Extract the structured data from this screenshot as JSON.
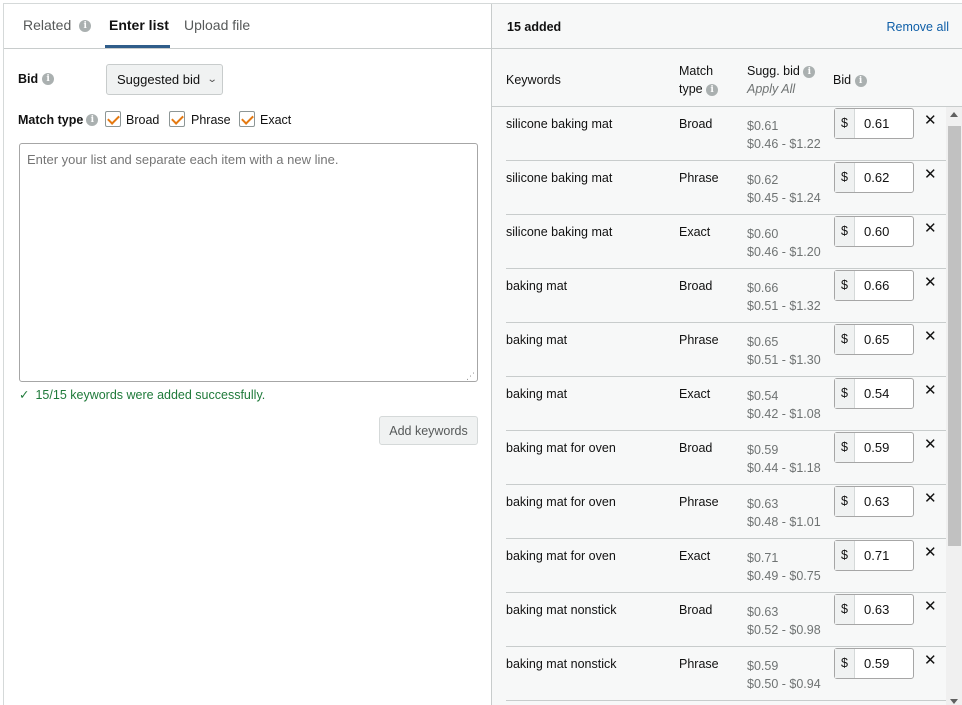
{
  "tabs": [
    {
      "label": "Related"
    },
    {
      "label": "Enter list"
    },
    {
      "label": "Upload file"
    }
  ],
  "bid": {
    "label": "Bid",
    "dropdown_value": "Suggested bid"
  },
  "match_type": {
    "label": "Match type",
    "options": [
      {
        "label": "Broad",
        "checked": true
      },
      {
        "label": "Phrase",
        "checked": true
      },
      {
        "label": "Exact",
        "checked": true
      }
    ]
  },
  "list_input": {
    "placeholder": "Enter your list and separate each item with a new line.",
    "value": ""
  },
  "success_message": "15/15 keywords were added successfully.",
  "add_keywords_label": "Add keywords",
  "right": {
    "added_label": "15 added",
    "remove_all_label": "Remove all",
    "columns": {
      "keywords": "Keywords",
      "match_type_line1": "Match",
      "match_type_line2": "type",
      "sugg_bid": "Sugg. bid",
      "apply_all": "Apply All",
      "bid": "Bid"
    },
    "currency": "$",
    "rows": [
      {
        "keyword": "silicone baking mat",
        "match": "Broad",
        "sugg": "$0.61",
        "range": "$0.46 - $1.22",
        "bid": "0.61"
      },
      {
        "keyword": "silicone baking mat",
        "match": "Phrase",
        "sugg": "$0.62",
        "range": "$0.45 - $1.24",
        "bid": "0.62"
      },
      {
        "keyword": "silicone baking mat",
        "match": "Exact",
        "sugg": "$0.60",
        "range": "$0.46 - $1.20",
        "bid": "0.60"
      },
      {
        "keyword": "baking mat",
        "match": "Broad",
        "sugg": "$0.66",
        "range": "$0.51 - $1.32",
        "bid": "0.66"
      },
      {
        "keyword": "baking mat",
        "match": "Phrase",
        "sugg": "$0.65",
        "range": "$0.51 - $1.30",
        "bid": "0.65"
      },
      {
        "keyword": "baking mat",
        "match": "Exact",
        "sugg": "$0.54",
        "range": "$0.42 - $1.08",
        "bid": "0.54"
      },
      {
        "keyword": "baking mat for oven",
        "match": "Broad",
        "sugg": "$0.59",
        "range": "$0.44 - $1.18",
        "bid": "0.59"
      },
      {
        "keyword": "baking mat for oven",
        "match": "Phrase",
        "sugg": "$0.63",
        "range": "$0.48 - $1.01",
        "bid": "0.63"
      },
      {
        "keyword": "baking mat for oven",
        "match": "Exact",
        "sugg": "$0.71",
        "range": "$0.49 - $0.75",
        "bid": "0.71"
      },
      {
        "keyword": "baking mat nonstick",
        "match": "Broad",
        "sugg": "$0.63",
        "range": "$0.52 - $0.98",
        "bid": "0.63"
      },
      {
        "keyword": "baking mat nonstick",
        "match": "Phrase",
        "sugg": "$0.59",
        "range": "$0.50 - $0.94",
        "bid": "0.59"
      }
    ]
  },
  "colors": {
    "accent_tab": "#2f5d8a",
    "checkbox": "#e47911",
    "success": "#1f7a3a",
    "link": "#0f5fa8"
  }
}
